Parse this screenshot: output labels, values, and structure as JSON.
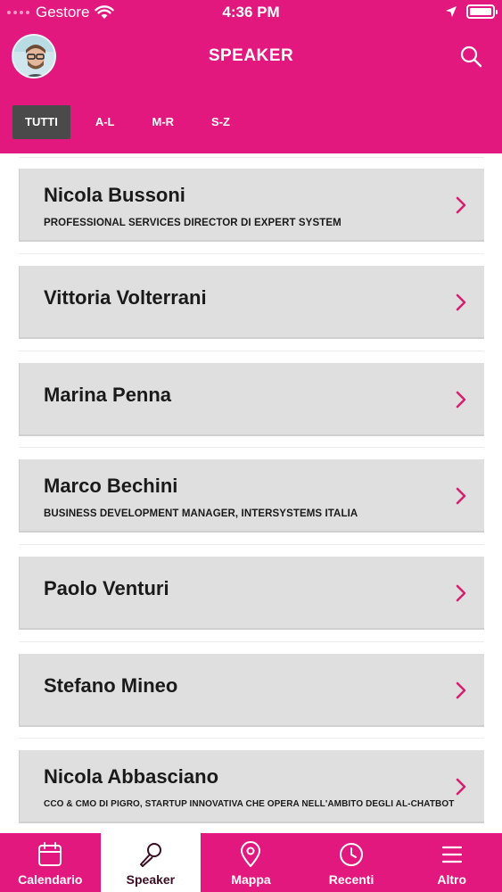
{
  "status_bar": {
    "carrier": "Gestore",
    "time": "4:36 PM"
  },
  "header": {
    "title": "SPEAKER",
    "avatar_icon": "user-avatar",
    "search_icon": "search-icon"
  },
  "filters": [
    {
      "label": "TUTTI",
      "active": true
    },
    {
      "label": "A-L",
      "active": false
    },
    {
      "label": "M-R",
      "active": false
    },
    {
      "label": "S-Z",
      "active": false
    }
  ],
  "speakers": [
    {
      "name": "Nicola Bussoni",
      "role": "PROFESSIONAL SERVICES DIRECTOR DI EXPERT SYSTEM"
    },
    {
      "name": "Vittoria Volterrani",
      "role": ""
    },
    {
      "name": "Marina Penna",
      "role": ""
    },
    {
      "name": "Marco Bechini",
      "role": "BUSINESS DEVELOPMENT MANAGER, INTERSYSTEMS ITALIA"
    },
    {
      "name": "Paolo Venturi",
      "role": ""
    },
    {
      "name": "Stefano Mineo",
      "role": ""
    },
    {
      "name": "Nicola Abbasciano",
      "role": "CCO & CMO DI PIGRO, STARTUP INNOVATIVA CHE OPERA NELL'AMBITO DEGLI AL-CHATBOT"
    }
  ],
  "tabbar": [
    {
      "label": "Calendario",
      "icon": "calendar-icon",
      "active": false
    },
    {
      "label": "Speaker",
      "icon": "microphone-icon",
      "active": true
    },
    {
      "label": "Mappa",
      "icon": "map-pin-icon",
      "active": false
    },
    {
      "label": "Recenti",
      "icon": "clock-icon",
      "active": false
    },
    {
      "label": "Altro",
      "icon": "menu-icon",
      "active": false
    }
  ],
  "colors": {
    "brand": "#e3187f",
    "card": "#e0dfe0",
    "active_tab": "#4a4a4a",
    "chevron": "#d6206f"
  }
}
